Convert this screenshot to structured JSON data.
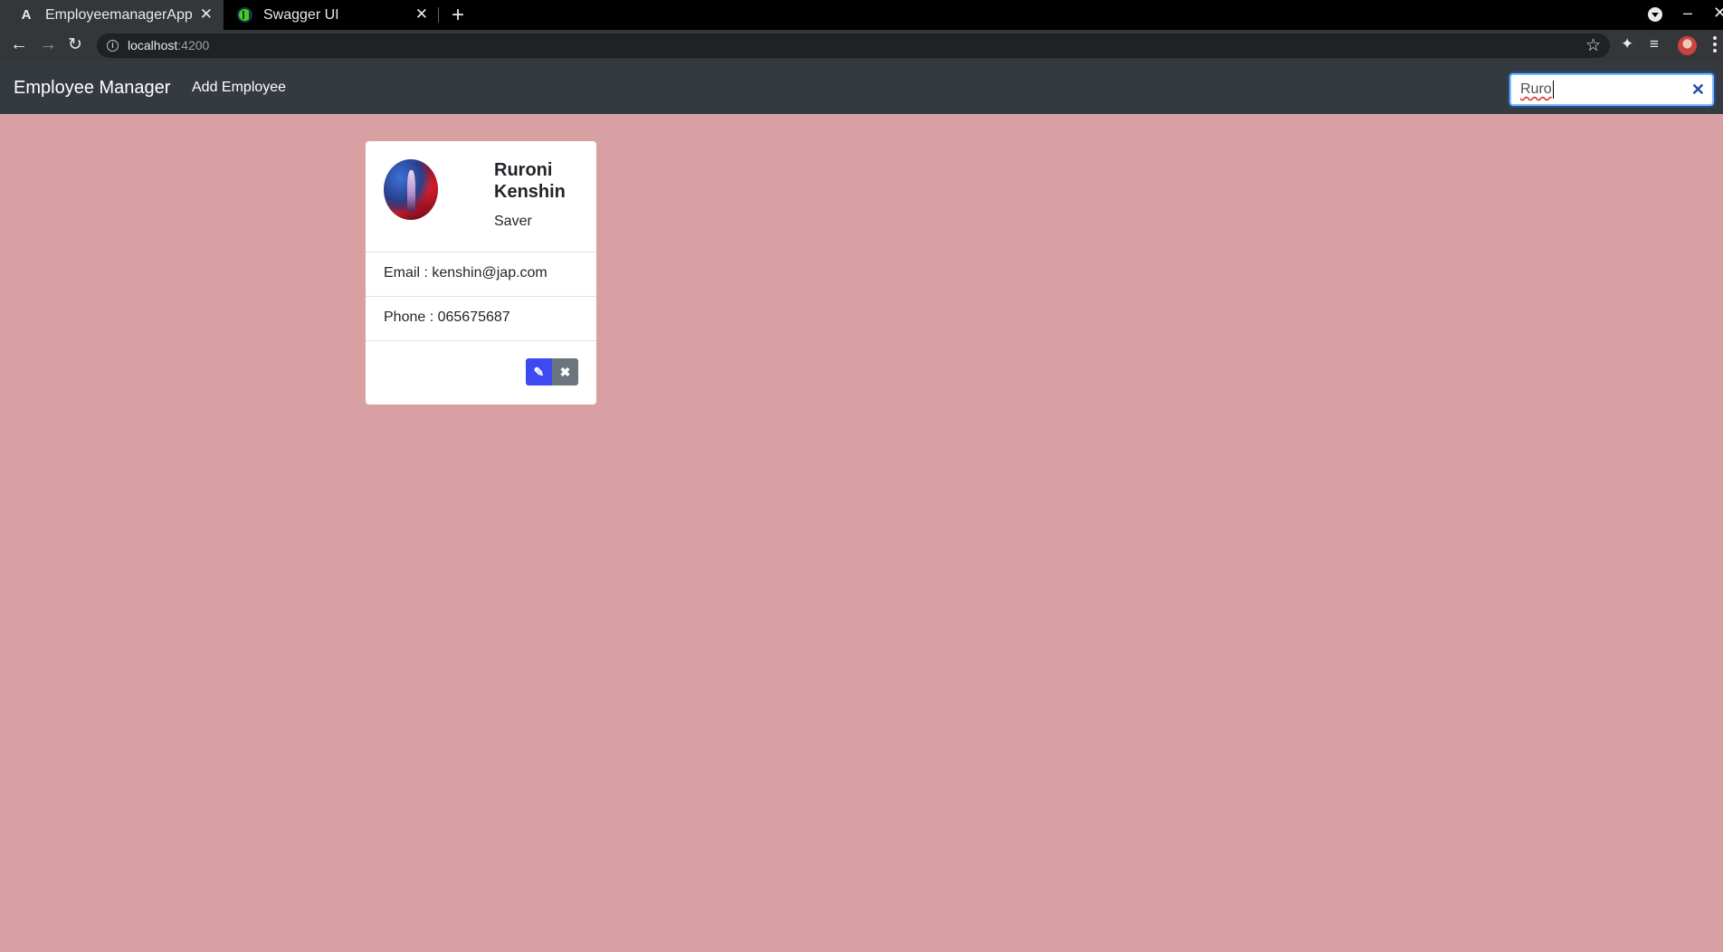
{
  "browser": {
    "tabs": [
      {
        "title": "EmployeemanagerApp",
        "icon": "angular-icon",
        "active": true
      },
      {
        "title": "Swagger UI",
        "icon": "swagger-icon",
        "active": false
      }
    ],
    "url_host": "localhost",
    "url_port": ":4200"
  },
  "navbar": {
    "brand": "Employee Manager",
    "add_employee": "Add Employee",
    "search": {
      "value": "Ruro",
      "clear_icon": "close-icon"
    }
  },
  "employee": {
    "name": "Ruroni Kenshin",
    "job_title": "Saver",
    "email_label": "Email : ",
    "email": "kenshin@jap.com",
    "phone_label": "Phone : ",
    "phone": "065675687"
  },
  "colors": {
    "page_background": "#d9a0a4",
    "navbar": "#343a40",
    "edit_button": "#3d4af2",
    "delete_button": "#6c757d"
  }
}
